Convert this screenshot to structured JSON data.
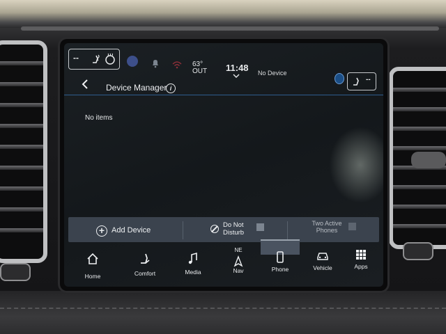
{
  "status": {
    "climate_left_value": "--",
    "climate_right_value": "--",
    "outside_temp": "63°",
    "outside_label": "OUT",
    "time": "11:48",
    "device_status": "No Device"
  },
  "header": {
    "title": "Device Manager"
  },
  "content": {
    "empty_message": "No items"
  },
  "actions": {
    "add_device": "Add Device",
    "do_not_disturb_line1": "Do Not",
    "do_not_disturb_line2": "Disturb",
    "two_active_line1": "Two Active",
    "two_active_line2": "Phones"
  },
  "nav": {
    "items": [
      {
        "label": "Home",
        "icon": "home-icon"
      },
      {
        "label": "Comfort",
        "icon": "seat-icon"
      },
      {
        "label": "Media",
        "icon": "music-note-icon"
      },
      {
        "label": "Nav",
        "icon": "navigation-arrow-icon",
        "compass": "NE"
      },
      {
        "label": "Phone",
        "icon": "phone-icon"
      },
      {
        "label": "Vehicle",
        "icon": "car-icon"
      },
      {
        "label": "Apps",
        "icon": "grid-icon"
      }
    ],
    "active": "Phone"
  },
  "colors": {
    "accent_rule": "#2e5d8f",
    "action_bar": "#3b434e",
    "bluetooth": "#1b4e86"
  }
}
